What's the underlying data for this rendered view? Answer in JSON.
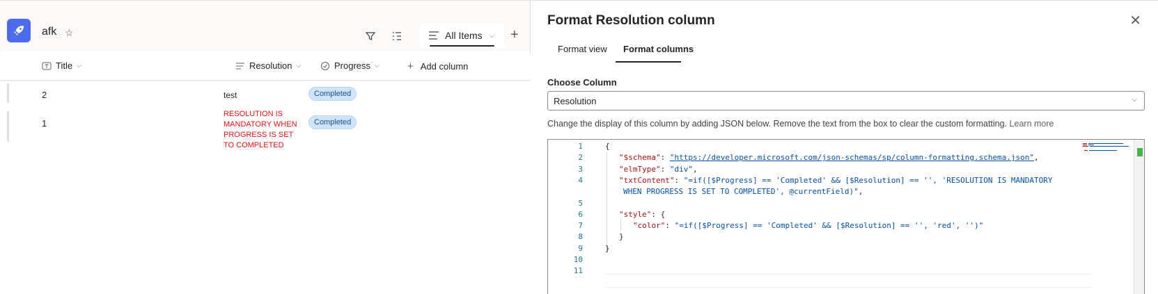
{
  "list": {
    "name": "afk",
    "view_name": "All Items",
    "columns": [
      {
        "label": "Title",
        "icon": "text-column-icon"
      },
      {
        "label": "Resolution",
        "icon": "multiline-text-icon"
      },
      {
        "label": "Progress",
        "icon": "choice-column-icon"
      }
    ],
    "add_column_label": "Add column",
    "rows": [
      {
        "title": "2",
        "resolution": "test",
        "progress": "Completed"
      },
      {
        "title": "1",
        "resolution": "RESOLUTION IS MANDATORY WHEN PROGRESS IS SET TO COMPLETED",
        "progress": "Completed"
      }
    ]
  },
  "panel": {
    "title": "Format Resolution column",
    "tabs": [
      "Format view",
      "Format columns"
    ],
    "active_tab": "Format columns",
    "choose_column_label": "Choose Column",
    "selected_column": "Resolution",
    "help_text": "Change the display of this column by adding JSON below. Remove the text from the box to clear the custom formatting.",
    "learn_more": "Learn more",
    "code_lines": [
      {
        "num": "1",
        "text": "{"
      },
      {
        "num": "2",
        "key": "\"$schema\"",
        "sep": ": ",
        "val": "\"https://developer.microsoft.com/json-schemas/sp/column-formatting.schema.json\"",
        "tail": ","
      },
      {
        "num": "3",
        "key": "\"elmType\"",
        "sep": ": ",
        "val": "\"div\"",
        "tail": ","
      },
      {
        "num": "4",
        "key": "\"txtContent\"",
        "sep": ": ",
        "val": "\"=if([$Progress] == 'Completed' && [$Resolution] == '', 'RESOLUTION IS MANDATORY",
        "tail": ""
      },
      {
        "num": "",
        "val": "WHEN PROGRESS IS SET TO COMPLETED', @currentField)\"",
        "tail": ","
      },
      {
        "num": "5",
        "text": ""
      },
      {
        "num": "6",
        "key": "\"style\"",
        "sep": ": ",
        "tail": "{"
      },
      {
        "num": "7",
        "key": "\"color\"",
        "sep": ": ",
        "val": "\"=if([$Progress] == 'Completed' && [$Resolution] == '', 'red', '')\"",
        "tail": ""
      },
      {
        "num": "8",
        "text": "}"
      },
      {
        "num": "9",
        "text": "}"
      },
      {
        "num": "10",
        "text": ""
      },
      {
        "num": "11",
        "text": ""
      }
    ]
  },
  "colors": {
    "accent": "#4f6bed",
    "pill_bg": "#cfe4fa",
    "error_text": "#e11111"
  }
}
